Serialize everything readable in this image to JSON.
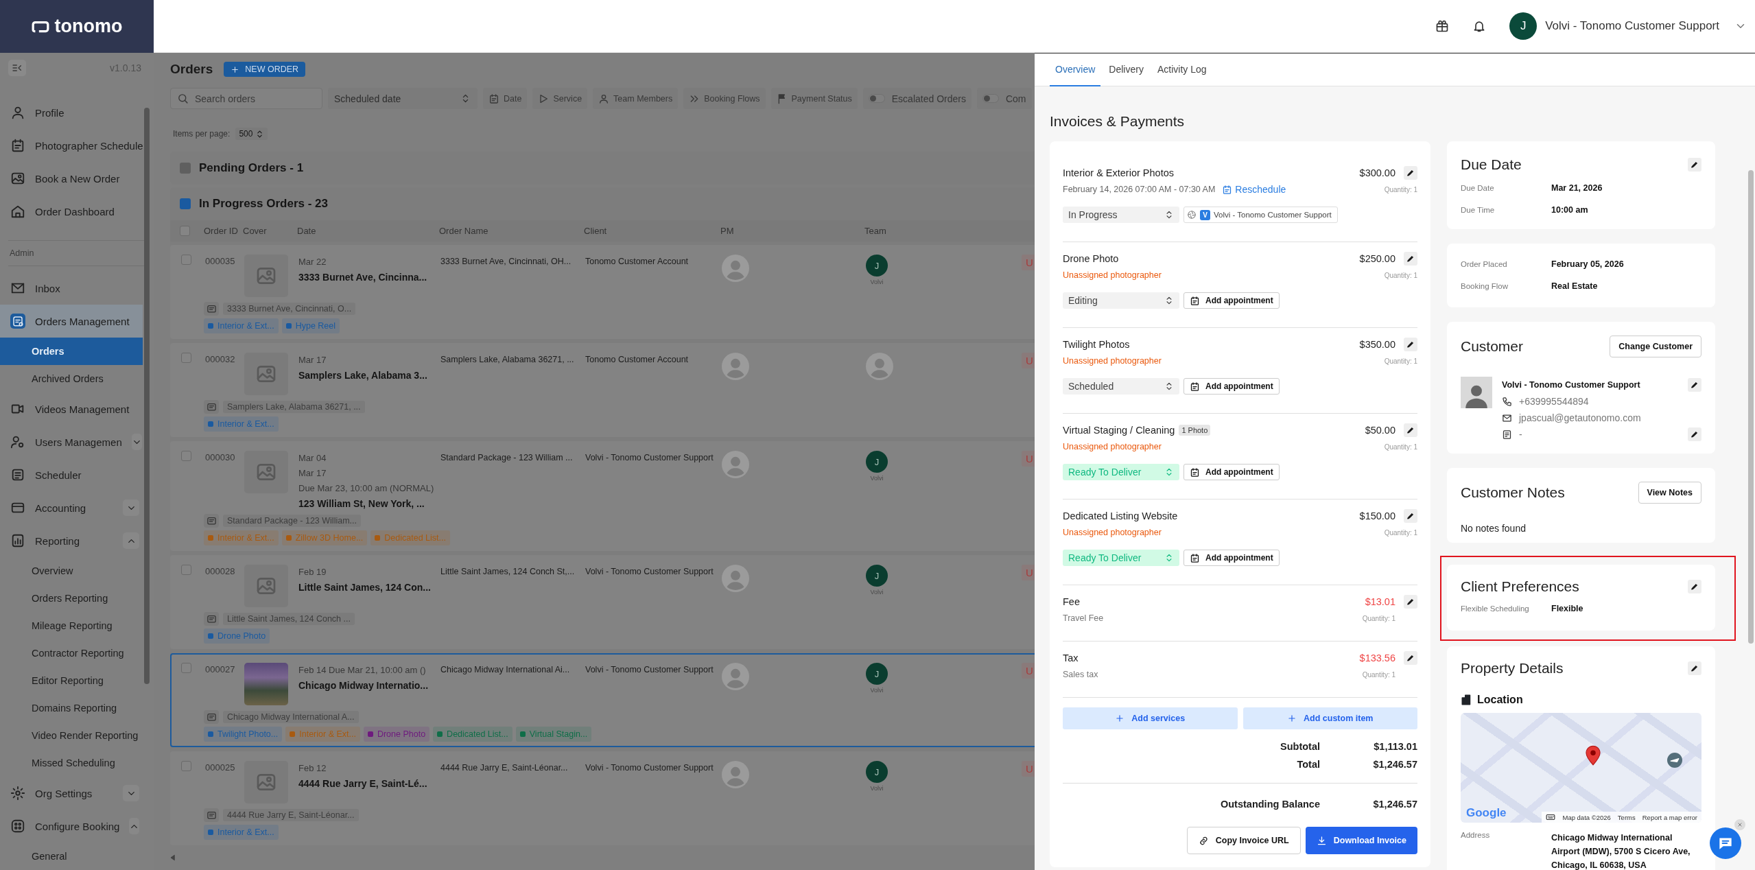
{
  "brand": {
    "logo_text": "tonomo",
    "version": "v1.0.13"
  },
  "header": {
    "user_initial": "J",
    "user_name": "Volvi - Tonomo Customer Support"
  },
  "sidebar": {
    "items": [
      {
        "kind": "link",
        "label": "Profile",
        "selected": false
      },
      {
        "kind": "link",
        "label": "Photographer Schedule",
        "selected": false
      },
      {
        "kind": "link",
        "label": "Book a New Order",
        "selected": false
      },
      {
        "kind": "link",
        "label": "Order Dashboard",
        "selected": false
      },
      {
        "kind": "section",
        "label": "Admin"
      },
      {
        "kind": "link",
        "label": "Inbox",
        "selected": false
      },
      {
        "kind": "link",
        "label": "Orders Management",
        "selected": true,
        "children": [
          {
            "label": "Orders",
            "selected": true
          },
          {
            "label": "Archived Orders",
            "selected": false
          }
        ]
      },
      {
        "kind": "link",
        "label": "Videos Management",
        "selected": false
      },
      {
        "kind": "group",
        "label": "Users Managemen",
        "selected": false,
        "expanded": false
      },
      {
        "kind": "link",
        "label": "Scheduler",
        "selected": false
      },
      {
        "kind": "group",
        "label": "Accounting",
        "selected": false,
        "expanded": false
      },
      {
        "kind": "group",
        "label": "Reporting",
        "selected": false,
        "expanded": true,
        "children": [
          {
            "label": "Overview",
            "selected": false
          },
          {
            "label": "Orders Reporting",
            "selected": false
          },
          {
            "label": "Mileage Reporting",
            "selected": false
          },
          {
            "label": "Contractor Reporting",
            "selected": false
          },
          {
            "label": "Editor Reporting",
            "selected": false
          },
          {
            "label": "Domains Reporting",
            "selected": false
          },
          {
            "label": "Video Render Reporting",
            "selected": false
          },
          {
            "label": "Missed Scheduling",
            "selected": false
          }
        ]
      },
      {
        "kind": "group",
        "label": "Org Settings",
        "selected": false,
        "expanded": false
      },
      {
        "kind": "group",
        "label": "Configure Booking",
        "selected": false,
        "expanded": true,
        "children": [
          {
            "label": "General",
            "selected": false
          }
        ]
      }
    ]
  },
  "orders": {
    "title": "Orders",
    "new_order_button": "NEW ORDER",
    "search": {
      "placeholder": "Search orders"
    },
    "date_select": "Scheduled date",
    "filters": [
      {
        "kind": "chip",
        "label": "Date"
      },
      {
        "kind": "chip",
        "label": "Service"
      },
      {
        "kind": "chip",
        "label": "Team Members"
      },
      {
        "kind": "chip",
        "label": "Booking Flows"
      },
      {
        "kind": "chip",
        "label": "Payment Status"
      },
      {
        "kind": "toggle",
        "label": "Escalated Orders",
        "on": false
      },
      {
        "kind": "toggle",
        "label": "Com",
        "on": false
      }
    ],
    "items_per_page": {
      "label": "Items per page:",
      "value": "500"
    },
    "groups": [
      {
        "title": "Pending Orders - 1",
        "color": "#5f5f5f"
      },
      {
        "title": "In Progress Orders - 23",
        "color": "#1a5aa0"
      }
    ],
    "table": {
      "all_checked": false,
      "columns": [
        "Order ID",
        "Cover",
        "Date",
        "Order Name",
        "Client",
        "PM",
        "Team"
      ],
      "rows": [
        {
          "order_id": "000035",
          "checked": false,
          "has_cover_photo": false,
          "dates": [
            "Mar 22"
          ],
          "title": "3333 Burnet Ave, Cincinna...",
          "order_name": "3333 Burnet Ave, Cincinnati, OH...",
          "client": "Tonomo Customer Account",
          "team": {
            "kind": "member",
            "initial": "J",
            "name": "Volvi"
          },
          "payment": "U",
          "note": "3333 Burnet Ave, Cincinnati, O...",
          "tags": [
            {
              "label": "Interior & Ext...",
              "color": "#1a5aa0"
            },
            {
              "label": "Hype Reel",
              "color": "#1a5aa0"
            }
          ],
          "selected": false
        },
        {
          "order_id": "000032",
          "checked": false,
          "has_cover_photo": false,
          "dates": [
            "Mar 17"
          ],
          "title": "Samplers Lake, Alabama 3...",
          "order_name": "Samplers Lake, Alabama 36271, ...",
          "client": "Tonomo Customer Account",
          "team": {
            "kind": "empty"
          },
          "payment": "U",
          "note": "Samplers Lake, Alabama 36271, ...",
          "tags": [
            {
              "label": "Interior & Ext...",
              "color": "#1a5aa0"
            }
          ],
          "selected": false
        },
        {
          "order_id": "000030",
          "checked": false,
          "has_cover_photo": false,
          "dates": [
            "Mar 04",
            "Mar 17",
            "Due Mar 23, 10:00 am (NORMAL)"
          ],
          "title": "123 William St, New York, ...",
          "order_name": "Standard Package - 123 William ...",
          "client": "Volvi - Tonomo Customer Support",
          "team": {
            "kind": "member",
            "initial": "J",
            "name": "Volvi"
          },
          "payment": "U",
          "note": "Standard Package - 123 William...",
          "tags": [
            {
              "label": "Interior & Ext...",
              "color": "#a85a10"
            },
            {
              "label": "Zillow 3D Home...",
              "color": "#a85a10"
            },
            {
              "label": "Dedicated List...",
              "color": "#a85a10"
            }
          ],
          "selected": false
        },
        {
          "order_id": "000028",
          "checked": false,
          "has_cover_photo": false,
          "dates": [
            "Feb 19"
          ],
          "title": "Little Saint James, 124 Con...",
          "order_name": "Little Saint James, 124 Conch St,...",
          "client": "Volvi - Tonomo Customer Support",
          "team": {
            "kind": "member",
            "initial": "J",
            "name": "Volvi"
          },
          "payment": "U",
          "note": "Little Saint James, 124 Conch ...",
          "tags": [
            {
              "label": "Drone Photo",
              "color": "#1a5aa0"
            }
          ],
          "selected": false
        },
        {
          "order_id": "000027",
          "checked": false,
          "has_cover_photo": true,
          "dates": [
            "Feb 14 Due Mar 21, 10:00 am ()"
          ],
          "title": "Chicago Midway Internatio...",
          "order_name": "Chicago Midway International Ai...",
          "client": "Volvi - Tonomo Customer Support",
          "team": {
            "kind": "member",
            "initial": "J",
            "name": "Volvi"
          },
          "payment": "U",
          "note": "Chicago Midway International A...",
          "tags": [
            {
              "label": "Twilight Photo...",
              "color": "#1a5aa0"
            },
            {
              "label": "Interior & Ext...",
              "color": "#a85a10"
            },
            {
              "label": "Drone Photo",
              "color": "#6e1a7e"
            },
            {
              "label": "Dedicated List...",
              "color": "#0f6e48"
            },
            {
              "label": "Virtual Stagin...",
              "color": "#0f6e48"
            }
          ],
          "selected": true
        },
        {
          "order_id": "000025",
          "checked": false,
          "has_cover_photo": false,
          "dates": [
            "Feb 12"
          ],
          "title": "4444 Rue Jarry E, Saint-Lé...",
          "order_name": "4444 Rue Jarry E, Saint-Léonar...",
          "client": "Volvi - Tonomo Customer Support",
          "team": {
            "kind": "member",
            "initial": "J",
            "name": "Volvi"
          },
          "payment": "U",
          "note": "4444 Rue Jarry E, Saint-Léonar...",
          "tags": [
            {
              "label": "Interior & Ext...",
              "color": "#1a5aa0"
            }
          ],
          "selected": false
        }
      ]
    }
  },
  "drawer": {
    "tabs": [
      {
        "label": "Overview",
        "selected": true
      },
      {
        "label": "Delivery",
        "selected": false
      },
      {
        "label": "Activity Log",
        "selected": false
      }
    ],
    "invoice": {
      "title": "Invoices & Payments",
      "items": [
        {
          "kind": "service",
          "name": "Interior & Exterior Photos",
          "price": "$300.00",
          "quantity": "Quantity: 1",
          "schedule": "February 14, 2026 07:00 AM - 07:30 AM",
          "reschedule": "Reschedule",
          "status": {
            "label": "In Progress",
            "kind": "neutral"
          },
          "assignee": {
            "initial": "V",
            "name": "Volvi - Tonomo Customer Support"
          }
        },
        {
          "kind": "service",
          "name": "Drone Photo",
          "price": "$250.00",
          "quantity": "Quantity: 1",
          "warning": "Unassigned photographer",
          "status": {
            "label": "Editing",
            "kind": "neutral"
          },
          "action": "Add appointment"
        },
        {
          "kind": "service",
          "name": "Twilight Photos",
          "price": "$350.00",
          "quantity": "Quantity: 1",
          "warning": "Unassigned photographer",
          "status": {
            "label": "Scheduled",
            "kind": "neutral"
          },
          "action": "Add appointment"
        },
        {
          "kind": "service",
          "name": "Virtual Staging / Cleaning",
          "badge": "1 Photo",
          "price": "$50.00",
          "quantity": "Quantity: 1",
          "warning": "Unassigned photographer",
          "status": {
            "label": "Ready To Deliver",
            "kind": "success"
          },
          "action": "Add appointment"
        },
        {
          "kind": "service",
          "name": "Dedicated Listing Website",
          "price": "$150.00",
          "quantity": "Quantity: 1",
          "warning": "Unassigned photographer",
          "status": {
            "label": "Ready To Deliver",
            "kind": "success"
          },
          "action": "Add appointment"
        },
        {
          "kind": "charge",
          "name": "Fee",
          "detail": "Travel Fee",
          "price": "$13.01",
          "quantity": "Quantity: 1"
        },
        {
          "kind": "charge",
          "name": "Tax",
          "detail": "Sales tax",
          "price": "$133.56",
          "quantity": "Quantity: 1"
        }
      ],
      "add_buttons": [
        "Add services",
        "Add custom item"
      ],
      "totals": [
        {
          "label": "Subtotal",
          "value": "$1,113.01"
        },
        {
          "label": "Total",
          "value": "$1,246.57"
        }
      ],
      "balance": {
        "label": "Outstanding Balance",
        "value": "$1,246.57"
      },
      "actions": [
        "Copy Invoice URL",
        "Download Invoice"
      ]
    },
    "due_date": {
      "title": "Due Date",
      "fields": [
        {
          "label": "Due Date",
          "value": "Mar 21, 2026"
        },
        {
          "label": "Due Time",
          "value": "10:00 am"
        }
      ]
    },
    "order_info": {
      "fields": [
        {
          "label": "Order Placed",
          "value": "February 05, 2026"
        },
        {
          "label": "Booking Flow",
          "value": "Real Estate"
        }
      ]
    },
    "customer": {
      "title": "Customer",
      "button": "Change Customer",
      "name": "Volvi - Tonomo Customer Support",
      "phone": "+639995544894",
      "email": "jpascual@getautonomo.com",
      "note": "-"
    },
    "customer_notes": {
      "title": "Customer Notes",
      "button": "View Notes",
      "empty_text": "No notes found"
    },
    "client_preferences": {
      "title": "Client Preferences",
      "highlighted": true,
      "fields": [
        {
          "label": "Flexible Scheduling",
          "value": "Flexible"
        }
      ]
    },
    "property_details": {
      "title": "Property Details",
      "location_title": "Location",
      "map": {
        "logo": "Google",
        "attribution": [
          "Map data ©2026",
          "Terms",
          "Report a map error"
        ]
      },
      "fields": [
        {
          "label": "Address",
          "value": "Chicago Midway International Airport (MDW), 5700 S Cicero Ave, Chicago, IL 60638, USA"
        }
      ]
    }
  }
}
